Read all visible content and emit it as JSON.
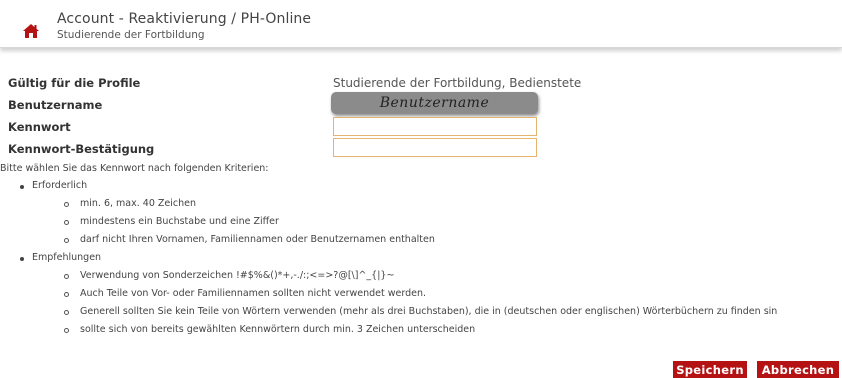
{
  "header": {
    "title": "Account - Reaktivierung  / PH-Online",
    "subtitle": "Studierende der Fortbildung",
    "home_icon": "home-icon",
    "home_icon_color": "#b51313"
  },
  "form": {
    "profiles_label": "Gültig für die Profile",
    "profiles_value": "Studierende der Fortbildung, Bedienstete",
    "username_label": "Benutzername",
    "username_value": "Benutzername",
    "password_label": "Kennwort",
    "password_value": "",
    "password_confirm_label": "Kennwort-Bestätigung",
    "password_confirm_value": ""
  },
  "criteria": {
    "intro": "Bitte wählen Sie das Kennwort nach folgenden Kriterien:",
    "required_title": "Erforderlich",
    "required_items": [
      "min. 6, max. 40 Zeichen",
      "mindestens ein Buchstabe und eine Ziffer",
      "darf nicht Ihren Vornamen, Familiennamen oder Benutzernamen enthalten"
    ],
    "recommended_title": "Empfehlungen",
    "recommended_items": [
      "Verwendung von Sonderzeichen !#$%&()*+,-./:;<=>?@[\\]^_{|}~",
      "Auch Teile von Vor- oder Familiennamen sollten nicht verwendet werden.",
      "Generell sollten Sie kein Teile von Wörtern verwenden (mehr als drei Buchstaben), die in (deutschen oder englischen) Wörterbüchern zu finden sin",
      "sollte sich von bereits gewählten Kennwörtern durch min. 3 Zeichen unterscheiden"
    ]
  },
  "buttons": {
    "save_label": "Speichern",
    "cancel_label": "Abbrechen"
  },
  "colors": {
    "accent": "#b51313",
    "input_border": "#e6b370",
    "masked_box": "#8b8b8b"
  }
}
